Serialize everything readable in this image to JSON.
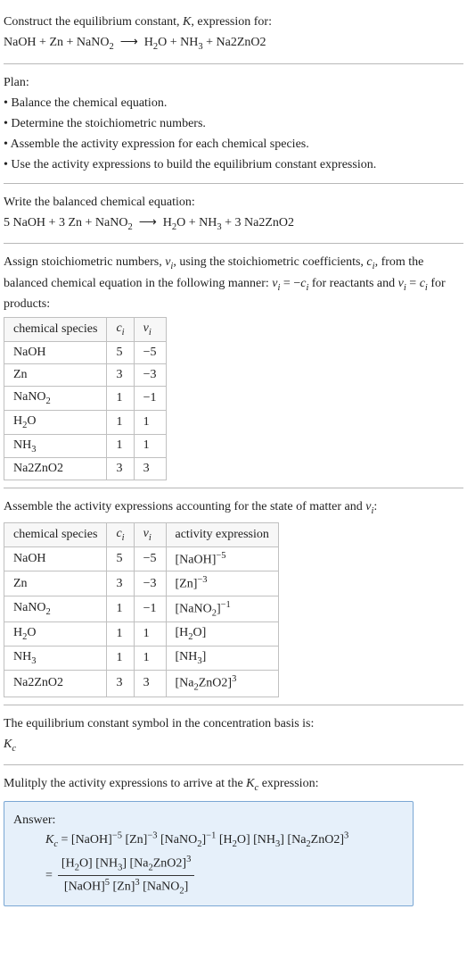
{
  "intro": {
    "line1": "Construct the equilibrium constant, K, expression for:",
    "equation": "NaOH + Zn + NaNO₂ ⟶ H₂O + NH₃ + Na2ZnO2"
  },
  "plan": {
    "heading": "Plan:",
    "items": [
      "• Balance the chemical equation.",
      "• Determine the stoichiometric numbers.",
      "• Assemble the activity expression for each chemical species.",
      "• Use the activity expressions to build the equilibrium constant expression."
    ]
  },
  "balanced": {
    "heading": "Write the balanced chemical equation:",
    "equation": "5 NaOH + 3 Zn + NaNO₂ ⟶ H₂O + NH₃ + 3 Na2ZnO2"
  },
  "assign": {
    "text": "Assign stoichiometric numbers, νᵢ, using the stoichiometric coefficients, cᵢ, from the balanced chemical equation in the following manner: νᵢ = −cᵢ for reactants and νᵢ = cᵢ for products:"
  },
  "table1": {
    "headers": [
      "chemical species",
      "cᵢ",
      "νᵢ"
    ],
    "rows": [
      [
        "NaOH",
        "5",
        "−5"
      ],
      [
        "Zn",
        "3",
        "−3"
      ],
      [
        "NaNO₂",
        "1",
        "−1"
      ],
      [
        "H₂O",
        "1",
        "1"
      ],
      [
        "NH₃",
        "1",
        "1"
      ],
      [
        "Na2ZnO2",
        "3",
        "3"
      ]
    ]
  },
  "assemble": {
    "text": "Assemble the activity expressions accounting for the state of matter and νᵢ:"
  },
  "table2": {
    "headers": [
      "chemical species",
      "cᵢ",
      "νᵢ",
      "activity expression"
    ],
    "rows": [
      {
        "sp": "NaOH",
        "c": "5",
        "v": "−5",
        "act": "[NaOH]⁻⁵"
      },
      {
        "sp": "Zn",
        "c": "3",
        "v": "−3",
        "act": "[Zn]⁻³"
      },
      {
        "sp": "NaNO₂",
        "c": "1",
        "v": "−1",
        "act": "[NaNO₂]⁻¹"
      },
      {
        "sp": "H₂O",
        "c": "1",
        "v": "1",
        "act": "[H₂O]"
      },
      {
        "sp": "NH₃",
        "c": "1",
        "v": "1",
        "act": "[NH₃]"
      },
      {
        "sp": "Na2ZnO2",
        "c": "3",
        "v": "3",
        "act": "[Na₂ZnO2]³"
      }
    ]
  },
  "symbol": {
    "line1": "The equilibrium constant symbol in the concentration basis is:",
    "kc": "K𝒸"
  },
  "final": {
    "line": "Mulitply the activity expressions to arrive at the K𝒸 expression:"
  },
  "answer": {
    "label": "Answer:",
    "eq1": "K𝒸 = [NaOH]⁻⁵ [Zn]⁻³ [NaNO₂]⁻¹ [H₂O] [NH₃] [Na₂ZnO2]³",
    "frac_num": "[H₂O] [NH₃] [Na₂ZnO2]³",
    "frac_den": "[NaOH]⁵ [Zn]³ [NaNO₂]",
    "equals": "= "
  },
  "chart_data": {
    "type": "table",
    "tables": [
      {
        "title": "Stoichiometric numbers",
        "columns": [
          "chemical species",
          "c_i",
          "ν_i"
        ],
        "rows": [
          [
            "NaOH",
            5,
            -5
          ],
          [
            "Zn",
            3,
            -3
          ],
          [
            "NaNO2",
            1,
            -1
          ],
          [
            "H2O",
            1,
            1
          ],
          [
            "NH3",
            1,
            1
          ],
          [
            "Na2ZnO2",
            3,
            3
          ]
        ]
      },
      {
        "title": "Activity expressions",
        "columns": [
          "chemical species",
          "c_i",
          "ν_i",
          "activity expression"
        ],
        "rows": [
          [
            "NaOH",
            5,
            -5,
            "[NaOH]^-5"
          ],
          [
            "Zn",
            3,
            -3,
            "[Zn]^-3"
          ],
          [
            "NaNO2",
            1,
            -1,
            "[NaNO2]^-1"
          ],
          [
            "H2O",
            1,
            1,
            "[H2O]"
          ],
          [
            "NH3",
            1,
            1,
            "[NH3]"
          ],
          [
            "Na2ZnO2",
            3,
            3,
            "[Na2ZnO2]^3"
          ]
        ]
      }
    ]
  }
}
